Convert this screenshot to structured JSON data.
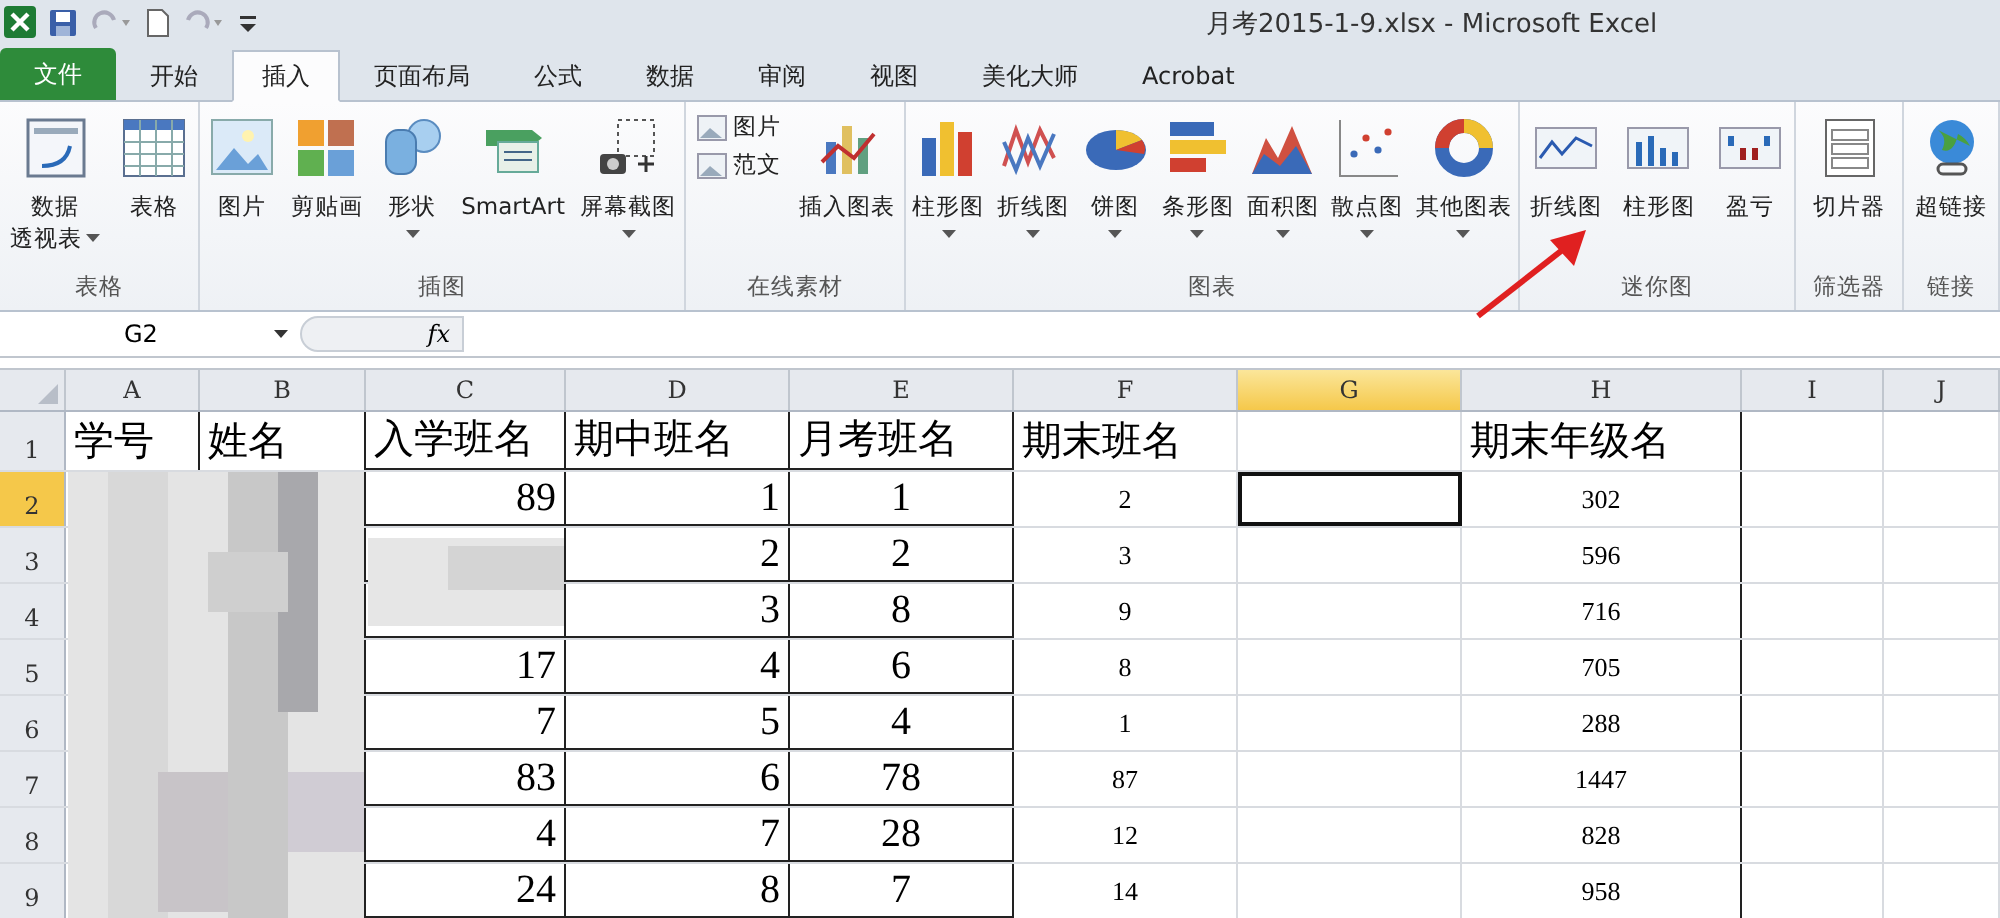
{
  "window": {
    "title": "月考2015-1-9.xlsx  -  Microsoft Excel"
  },
  "tabs": [
    {
      "label": "文件",
      "kind": "file",
      "selected": false
    },
    {
      "label": "开始",
      "kind": "tab",
      "selected": false
    },
    {
      "label": "插入",
      "kind": "tab",
      "selected": true
    },
    {
      "label": "页面布局",
      "kind": "tab",
      "selected": false
    },
    {
      "label": "公式",
      "kind": "tab",
      "selected": false
    },
    {
      "label": "数据",
      "kind": "tab",
      "selected": false
    },
    {
      "label": "审阅",
      "kind": "tab",
      "selected": false
    },
    {
      "label": "视图",
      "kind": "tab",
      "selected": false
    },
    {
      "label": "美化大师",
      "kind": "tab",
      "selected": false
    },
    {
      "label": "Acrobat",
      "kind": "tab",
      "selected": false
    }
  ],
  "ribbon": {
    "groups": [
      {
        "label": "表格",
        "buttons": [
          {
            "kind": "large",
            "lines": [
              "数据",
              "透视表"
            ],
            "dropdown": true
          },
          {
            "kind": "large",
            "lines": [
              "表格"
            ],
            "dropdown": false
          }
        ]
      },
      {
        "label": "插图",
        "buttons": [
          {
            "kind": "large",
            "lines": [
              "图片"
            ],
            "dropdown": false
          },
          {
            "kind": "large",
            "lines": [
              "剪贴画"
            ],
            "dropdown": false
          },
          {
            "kind": "large",
            "lines": [
              "形状"
            ],
            "dropdown": true
          },
          {
            "kind": "large",
            "lines": [
              "SmartArt"
            ],
            "dropdown": false
          },
          {
            "kind": "large",
            "lines": [
              "屏幕截图"
            ],
            "dropdown": true
          }
        ]
      },
      {
        "label": "在线素材",
        "buttons": [
          {
            "kind": "small-stack",
            "items": [
              "图片",
              "范文"
            ]
          },
          {
            "kind": "large",
            "lines": [
              "插入图表"
            ],
            "dropdown": false
          }
        ]
      },
      {
        "label": "图表",
        "buttons": [
          {
            "kind": "large",
            "lines": [
              "柱形图"
            ],
            "dropdown": true
          },
          {
            "kind": "large",
            "lines": [
              "折线图"
            ],
            "dropdown": true
          },
          {
            "kind": "large",
            "lines": [
              "饼图"
            ],
            "dropdown": true
          },
          {
            "kind": "large",
            "lines": [
              "条形图"
            ],
            "dropdown": true
          },
          {
            "kind": "large",
            "lines": [
              "面积图"
            ],
            "dropdown": true
          },
          {
            "kind": "large",
            "lines": [
              "散点图"
            ],
            "dropdown": true
          },
          {
            "kind": "large",
            "lines": [
              "其他图表"
            ],
            "dropdown": true
          }
        ]
      },
      {
        "label": "迷你图",
        "buttons": [
          {
            "kind": "large",
            "lines": [
              "折线图"
            ],
            "dropdown": false
          },
          {
            "kind": "large",
            "lines": [
              "柱形图"
            ],
            "dropdown": false
          },
          {
            "kind": "large",
            "lines": [
              "盈亏"
            ],
            "dropdown": false
          }
        ]
      },
      {
        "label": "筛选器",
        "buttons": [
          {
            "kind": "large",
            "lines": [
              "切片器"
            ],
            "dropdown": false
          }
        ]
      },
      {
        "label": "链接",
        "buttons": [
          {
            "kind": "large",
            "lines": [
              "超链接"
            ],
            "dropdown": false
          }
        ]
      }
    ]
  },
  "formula_bar": {
    "name_box": "G2",
    "fx": "fx"
  },
  "sheet": {
    "columns": [
      {
        "label": "A",
        "selected": false
      },
      {
        "label": "B",
        "selected": false
      },
      {
        "label": "C",
        "selected": false
      },
      {
        "label": "D",
        "selected": false
      },
      {
        "label": "E",
        "selected": false
      },
      {
        "label": "F",
        "selected": false
      },
      {
        "label": "G",
        "selected": true
      },
      {
        "label": "H",
        "selected": false
      },
      {
        "label": "I",
        "selected": false
      },
      {
        "label": "J",
        "selected": false
      }
    ],
    "rows": [
      {
        "number": "1",
        "selected": false,
        "cells": [
          "学号",
          "姓名",
          "入学班名",
          "期中班名",
          "月考班名",
          "期末班名",
          null,
          "期末年级名",
          null,
          null
        ]
      },
      {
        "number": "2",
        "selected": true,
        "cells": [
          null,
          null,
          "89",
          "1",
          "1",
          "2",
          null,
          "302",
          null,
          null
        ]
      },
      {
        "number": "3",
        "selected": false,
        "cells": [
          null,
          null,
          null,
          "2",
          "2",
          "3",
          null,
          "596",
          null,
          null
        ]
      },
      {
        "number": "4",
        "selected": false,
        "cells": [
          null,
          null,
          null,
          "3",
          "8",
          "9",
          null,
          "716",
          null,
          null
        ]
      },
      {
        "number": "5",
        "selected": false,
        "cells": [
          null,
          null,
          "17",
          "4",
          "6",
          "8",
          null,
          "705",
          null,
          null
        ]
      },
      {
        "number": "6",
        "selected": false,
        "cells": [
          null,
          null,
          "7",
          "5",
          "4",
          "1",
          null,
          "288",
          null,
          null
        ]
      },
      {
        "number": "7",
        "selected": false,
        "cells": [
          null,
          null,
          "83",
          "6",
          "78",
          "87",
          null,
          "1447",
          null,
          null
        ]
      },
      {
        "number": "8",
        "selected": false,
        "cells": [
          null,
          null,
          "4",
          "7",
          "28",
          "12",
          null,
          "828",
          null,
          null
        ]
      },
      {
        "number": "9",
        "selected": false,
        "cells": [
          null,
          null,
          "24",
          "8",
          "7",
          "14",
          null,
          "958",
          null,
          null
        ]
      }
    ]
  }
}
